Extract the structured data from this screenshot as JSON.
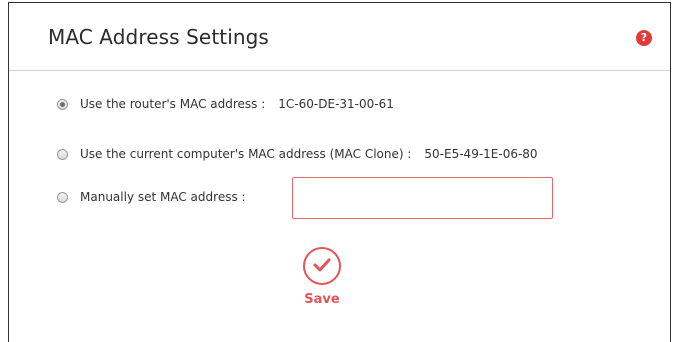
{
  "header": {
    "title": "MAC Address Settings",
    "help_icon": "question-icon"
  },
  "options": [
    {
      "label": "Use the router's MAC address :",
      "value": "1C-60-DE-31-00-61",
      "selected": true
    },
    {
      "label": "Use the current computer's MAC address (MAC Clone) :",
      "value": "50-E5-49-1E-06-80",
      "selected": false
    },
    {
      "label": "Manually set MAC address :",
      "value": "",
      "selected": false
    }
  ],
  "manual_input": {
    "value": "",
    "placeholder": ""
  },
  "save": {
    "label": "Save",
    "icon": "checkmark-icon"
  },
  "colors": {
    "accent": "#e25555",
    "input_border": "#e36a6a",
    "help": "#e23a3a"
  }
}
